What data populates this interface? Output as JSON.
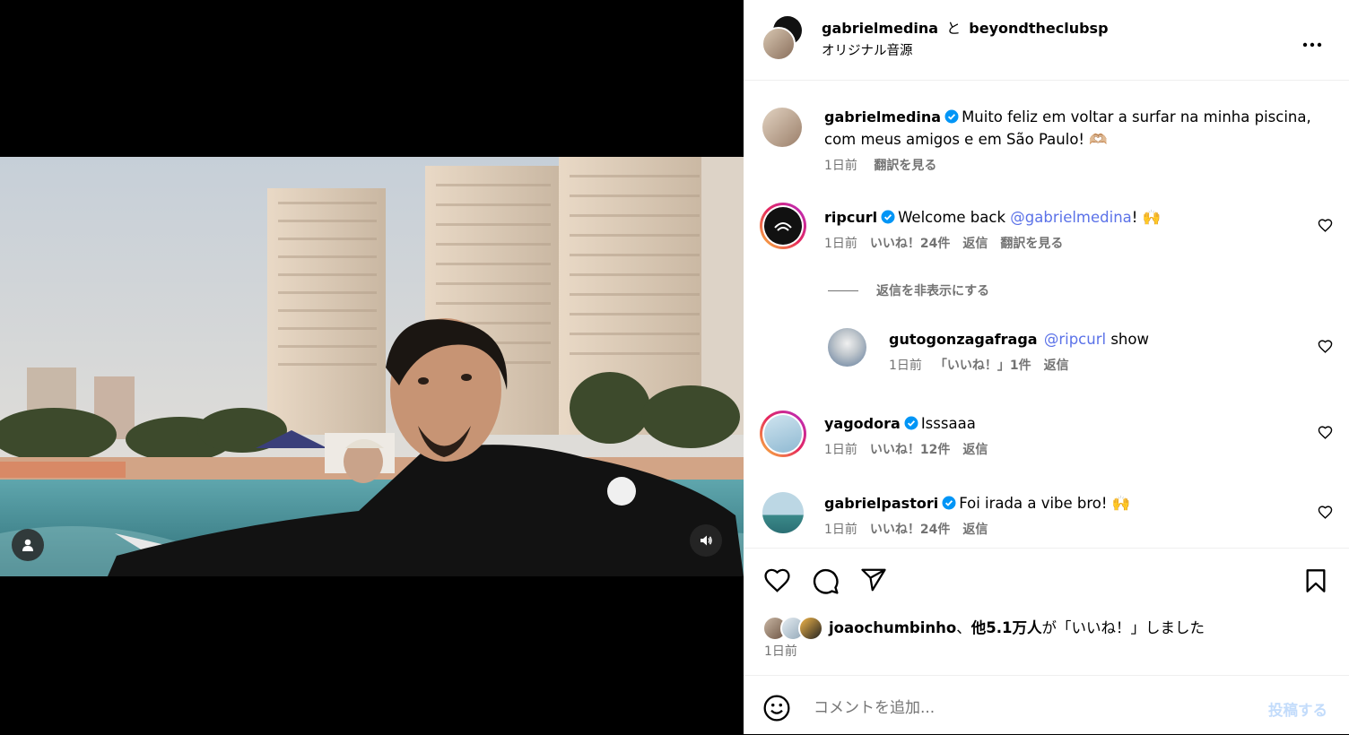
{
  "header": {
    "author": "gabrielmedina",
    "connector": "と",
    "collab": "beyondtheclubsp",
    "audio": "オリジナル音源",
    "more_icon": "more-horizontal-icon"
  },
  "caption": {
    "user": "gabrielmedina",
    "line1": "Muito feliz em voltar a surfar na minha piscina,",
    "line2": "com meus amigos e em São Paulo! 🫶🏼",
    "time": "1日前",
    "translate": "翻訳を見る"
  },
  "comments": [
    {
      "user": "ripcurl",
      "pre": "Welcome back ",
      "mention": "@gabrielmedina",
      "post": "! 🙌",
      "time": "1日前",
      "likes": "いいね！24件",
      "reply": "返信",
      "translate": "翻訳を見る",
      "hide_replies": "返信を非表示にする"
    },
    {
      "user": "gutogonzagafraga",
      "mention": "@ripcurl",
      "post": " show",
      "time": "1日前",
      "likes": "「いいね！」1件",
      "reply": "返信"
    },
    {
      "user": "yagodora",
      "text": "Isssaaa",
      "time": "1日前",
      "likes": "いいね！12件",
      "reply": "返信"
    },
    {
      "user": "gabrielpastori",
      "text": "Foi irada a vibe bro! 🙌",
      "time": "1日前",
      "likes": "いいね！24件",
      "reply": "返信"
    }
  ],
  "likes_line": {
    "user": "joaochumbinho",
    "sep": "、",
    "others": "他5.1万人",
    "suffix": "が「いいね！」しました",
    "time": "1日前"
  },
  "composer": {
    "placeholder": "コメントを追加...",
    "post_label": "投稿する",
    "post_color": "#c3dcfb"
  },
  "colors": {
    "verified": "#0095f6",
    "link": "#5b72e8",
    "meta": "#737373"
  }
}
